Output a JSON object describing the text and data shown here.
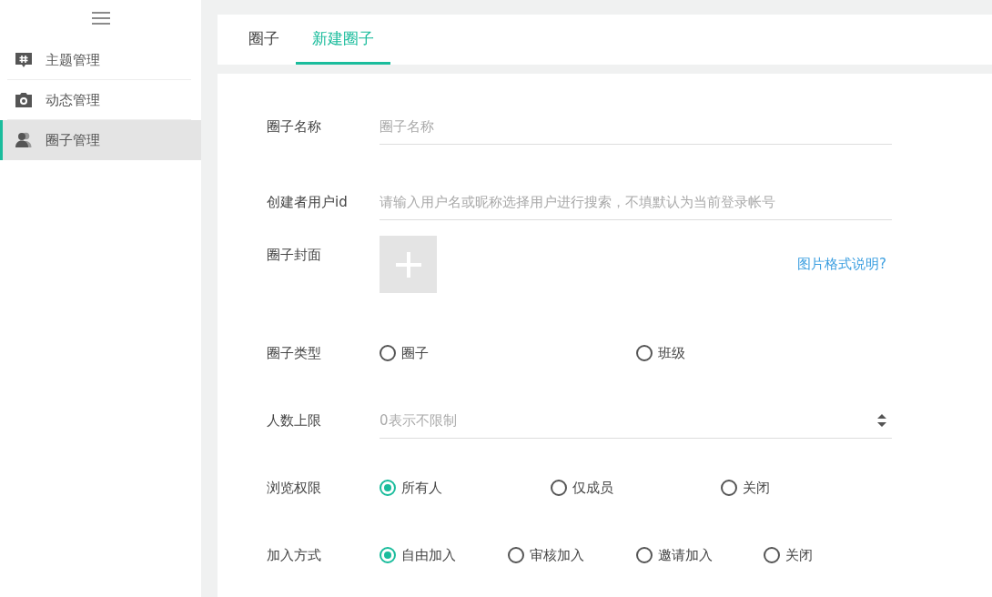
{
  "sidebar": {
    "items": [
      {
        "label": "主题管理",
        "selected": false
      },
      {
        "label": "动态管理",
        "selected": false
      },
      {
        "label": "圈子管理",
        "selected": true
      }
    ]
  },
  "tabs": [
    {
      "label": "圈子",
      "selected": false
    },
    {
      "label": "新建圈子",
      "selected": true
    }
  ],
  "form": {
    "fields": [
      {
        "kind": "text",
        "label": "圈子名称",
        "placeholder": "圈子名称"
      },
      {
        "kind": "text",
        "label": "创建者用户id",
        "placeholder": "请输入用户名或昵称选择用户进行搜索，不填默认为当前登录帐号"
      },
      {
        "kind": "upload",
        "label": "圈子封面",
        "link": "图片格式说明?"
      },
      {
        "kind": "radio",
        "label": "圈子类型",
        "options": [
          {
            "label": "圈子",
            "selected": false
          },
          {
            "label": "班级",
            "selected": false
          }
        ]
      },
      {
        "kind": "number",
        "label": "人数上限",
        "placeholder": "0表示不限制"
      },
      {
        "kind": "radio",
        "label": "浏览权限",
        "options": [
          {
            "label": "所有人",
            "selected": true
          },
          {
            "label": "仅成员",
            "selected": false
          },
          {
            "label": "关闭",
            "selected": false
          }
        ]
      },
      {
        "kind": "radio",
        "label": "加入方式",
        "options": [
          {
            "label": "自由加入",
            "selected": true
          },
          {
            "label": "审核加入",
            "selected": false
          },
          {
            "label": "邀请加入",
            "selected": false
          },
          {
            "label": "关闭",
            "selected": false
          }
        ]
      }
    ]
  }
}
